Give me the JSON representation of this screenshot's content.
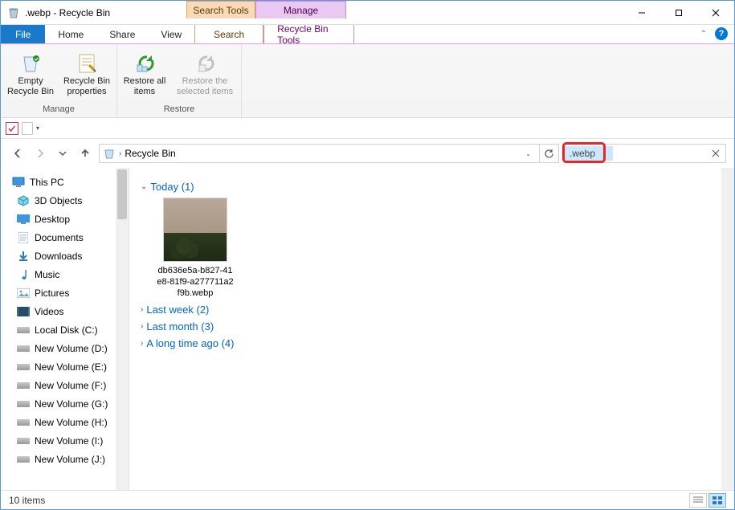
{
  "title": ".webp - Recycle Bin",
  "context_tabs": {
    "search": "Search Tools",
    "manage": "Manage"
  },
  "ribbon_tabs": {
    "file": "File",
    "home": "Home",
    "share": "Share",
    "view": "View",
    "search": "Search",
    "tools": "Recycle Bin Tools"
  },
  "ribbon": {
    "manage_group": "Manage",
    "restore_group": "Restore",
    "empty": "Empty\nRecycle Bin",
    "props": "Recycle Bin\nproperties",
    "restore_all": "Restore\nall items",
    "restore_sel": "Restore the\nselected items"
  },
  "breadcrumb": "Recycle Bin",
  "search_value": ".webp",
  "tree": {
    "root": "This PC",
    "items": [
      "3D Objects",
      "Desktop",
      "Documents",
      "Downloads",
      "Music",
      "Pictures",
      "Videos",
      "Local Disk (C:)",
      "New Volume (D:)",
      "New Volume (E:)",
      "New Volume (F:)",
      "New Volume (G:)",
      "New Volume (H:)",
      "New Volume (I:)",
      "New Volume (J:)"
    ]
  },
  "groups": {
    "today": "Today (1)",
    "lastweek": "Last week (2)",
    "lastmonth": "Last month (3)",
    "longtime": "A long time ago (4)"
  },
  "file0": "db636e5a-b827-41e8-81f9-a277711a2f9b.webp",
  "status": "10 items"
}
